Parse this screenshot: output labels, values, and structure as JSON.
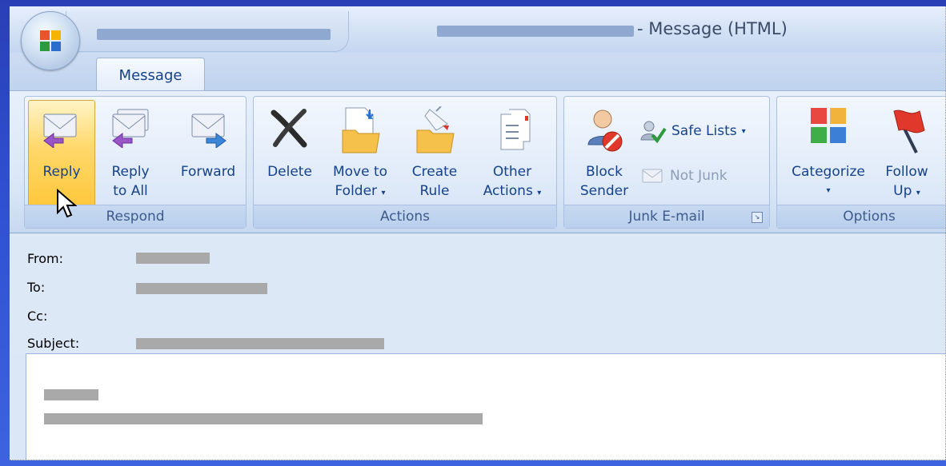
{
  "window": {
    "title": "- Message (HTML)"
  },
  "tabs": [
    {
      "label": "Message",
      "active": true
    }
  ],
  "ribbon": {
    "groups": [
      {
        "name": "Respond",
        "buttons": [
          {
            "label_line1": "Reply",
            "label_line2": "",
            "icon": "reply-icon",
            "highlighted": true
          },
          {
            "label_line1": "Reply",
            "label_line2": "to All",
            "icon": "reply-all-icon"
          },
          {
            "label_line1": "Forward",
            "label_line2": "",
            "icon": "forward-icon"
          }
        ]
      },
      {
        "name": "Actions",
        "buttons": [
          {
            "label_line1": "Delete",
            "label_line2": "",
            "icon": "delete-icon"
          },
          {
            "label_line1": "Move to",
            "label_line2": "Folder",
            "icon": "move-to-folder-icon",
            "dropdown": true
          },
          {
            "label_line1": "Create",
            "label_line2": "Rule",
            "icon": "create-rule-icon"
          },
          {
            "label_line1": "Other",
            "label_line2": "Actions",
            "icon": "other-actions-icon",
            "dropdown": true
          }
        ]
      },
      {
        "name": "Junk E-mail",
        "buttons": [
          {
            "label_line1": "Block",
            "label_line2": "Sender",
            "icon": "block-sender-icon"
          },
          {
            "label_line1": "Safe Lists",
            "label_line2": "",
            "icon": "safe-lists-icon",
            "dropdown": true
          },
          {
            "label_line1": "Not Junk",
            "label_line2": "",
            "icon": "not-junk-icon",
            "disabled": true
          }
        ]
      },
      {
        "name": "Options",
        "buttons": [
          {
            "label_line1": "Categorize",
            "label_line2": "",
            "icon": "categorize-icon",
            "dropdown": true
          },
          {
            "label_line1": "Follow",
            "label_line2": "Up",
            "icon": "follow-up-flag-icon",
            "dropdown": true
          }
        ]
      }
    ]
  },
  "headers": {
    "from_label": "From:",
    "to_label": "To:",
    "cc_label": "Cc:",
    "subject_label": "Subject:"
  },
  "colors": {
    "ribbon_text": "#15428b",
    "reply_highlight": "#ffd86a",
    "desktop_background": "#2f4fd0"
  }
}
